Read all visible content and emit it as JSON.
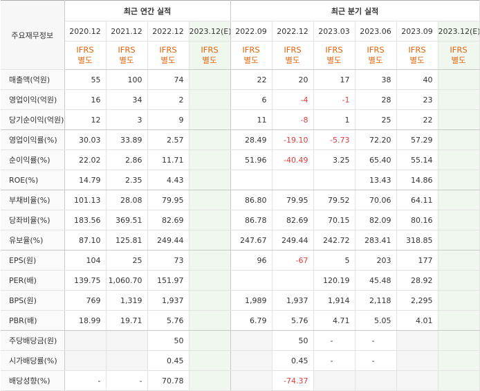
{
  "header": {
    "corner_label": "주요재무정보",
    "annual_title": "최근 연간 실적",
    "quarter_title": "최근 분기 실적",
    "annual_periods": [
      "2020.12",
      "2021.12",
      "2022.12",
      "2023.12(E)"
    ],
    "quarter_periods": [
      "2022.09",
      "2022.12",
      "2023.03",
      "2023.06",
      "2023.09",
      "2023.12(E)"
    ],
    "ifrs_line1": "IFRS",
    "ifrs_line2": "별도"
  },
  "rows": [
    {
      "label": "매출액(억원)",
      "annual": [
        "55",
        "100",
        "74",
        ""
      ],
      "quarter": [
        "22",
        "20",
        "17",
        "38",
        "40",
        ""
      ]
    },
    {
      "label": "영업이익(억원)",
      "annual": [
        "16",
        "34",
        "2",
        ""
      ],
      "quarter": [
        "6",
        "-4",
        "-1",
        "28",
        "23",
        ""
      ]
    },
    {
      "label": "당기순이익(억원)",
      "annual": [
        "12",
        "3",
        "9",
        ""
      ],
      "quarter": [
        "11",
        "-8",
        "1",
        "25",
        "22",
        ""
      ]
    },
    {
      "label": "영업이익률(%)",
      "annual": [
        "30.03",
        "33.89",
        "2.57",
        ""
      ],
      "quarter": [
        "28.49",
        "-19.10",
        "-5.73",
        "72.20",
        "57.29",
        ""
      ]
    },
    {
      "label": "순이익률(%)",
      "annual": [
        "22.02",
        "2.86",
        "11.71",
        ""
      ],
      "quarter": [
        "51.96",
        "-40.49",
        "3.25",
        "65.40",
        "55.14",
        ""
      ]
    },
    {
      "label": "ROE(%)",
      "annual": [
        "14.79",
        "2.35",
        "4.43",
        ""
      ],
      "quarter": [
        "",
        "",
        "",
        "13.43",
        "14.86",
        ""
      ]
    },
    {
      "label": "부채비율(%)",
      "annual": [
        "101.13",
        "28.08",
        "79.95",
        ""
      ],
      "quarter": [
        "86.80",
        "79.95",
        "79.52",
        "70.06",
        "64.11",
        ""
      ]
    },
    {
      "label": "당좌비율(%)",
      "annual": [
        "183.56",
        "369.51",
        "82.69",
        ""
      ],
      "quarter": [
        "86.78",
        "82.69",
        "70.15",
        "82.09",
        "80.16",
        ""
      ]
    },
    {
      "label": "유보율(%)",
      "annual": [
        "87.10",
        "125.81",
        "249.44",
        ""
      ],
      "quarter": [
        "247.67",
        "249.44",
        "242.72",
        "283.41",
        "318.85",
        ""
      ]
    },
    {
      "label": "EPS(원)",
      "annual": [
        "104",
        "25",
        "73",
        ""
      ],
      "quarter": [
        "96",
        "-67",
        "5",
        "203",
        "177",
        ""
      ]
    },
    {
      "label": "PER(배)",
      "annual": [
        "139.75",
        "1,060.70",
        "151.97",
        ""
      ],
      "quarter": [
        "",
        "",
        "120.19",
        "45.48",
        "28.92",
        ""
      ]
    },
    {
      "label": "BPS(원)",
      "annual": [
        "769",
        "1,319",
        "1,937",
        ""
      ],
      "quarter": [
        "1,989",
        "1,937",
        "1,914",
        "2,118",
        "2,295",
        ""
      ]
    },
    {
      "label": "PBR(배)",
      "annual": [
        "18.99",
        "19.71",
        "5.76",
        ""
      ],
      "quarter": [
        "6.79",
        "5.76",
        "4.71",
        "5.05",
        "4.01",
        ""
      ]
    },
    {
      "label": "주당배당금(원)",
      "annual": [
        "",
        "",
        "50",
        ""
      ],
      "quarter": [
        "",
        "50",
        "-",
        "-",
        "",
        ""
      ]
    },
    {
      "label": "시가배당률(%)",
      "annual": [
        "",
        "",
        "0.45",
        ""
      ],
      "quarter": [
        "",
        "0.45",
        "-",
        "-",
        "",
        ""
      ]
    },
    {
      "label": "배당성향(%)",
      "annual": [
        "-",
        "-",
        "70.78",
        ""
      ],
      "quarter": [
        "",
        "-74.37",
        "",
        "",
        "",
        ""
      ]
    }
  ]
}
